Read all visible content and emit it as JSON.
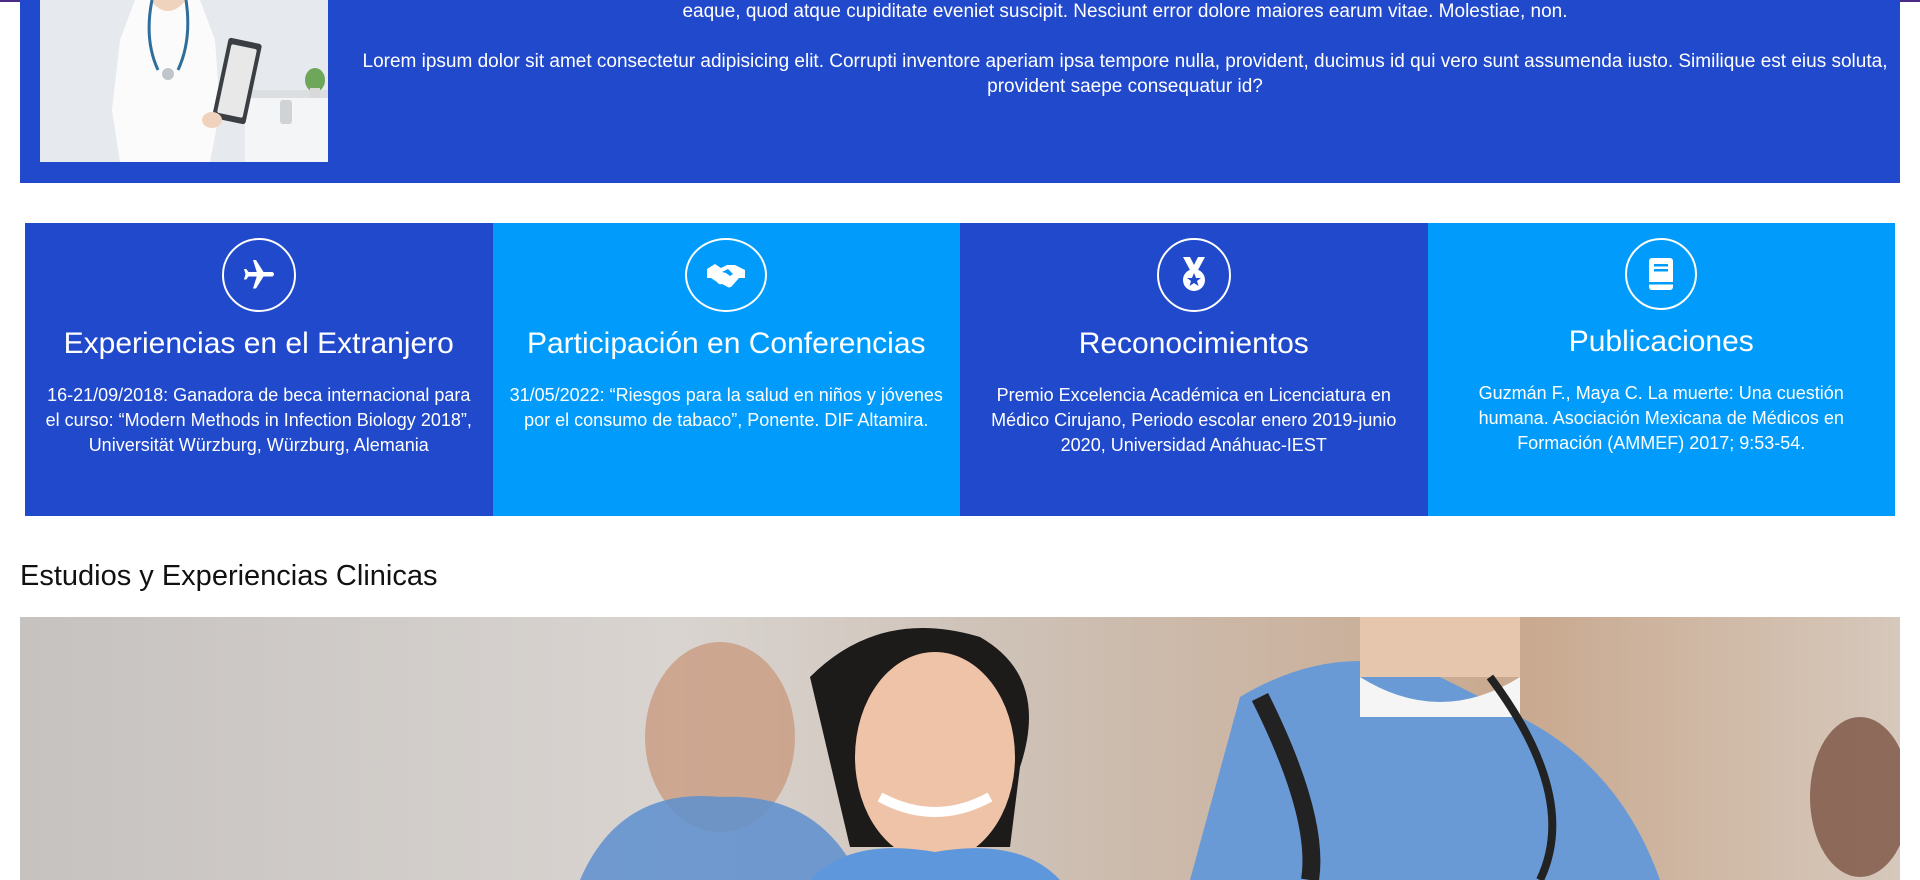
{
  "intro": {
    "paragraph_1": "eaque, quod atque cupiditate eveniet suscipit. Nesciunt error dolore maiores earum vitae. Molestiae, non.",
    "paragraph_2": "Lorem ipsum dolor sit amet consectetur adipisicing elit. Corrupti inventore aperiam ipsa tempore nulla, provident, ducimus id qui vero sunt assumenda iusto. Similique est eius soluta, provident saepe consequatur id?"
  },
  "cards": [
    {
      "icon": "airplane-icon",
      "title": "Experiencias en el Extranjero",
      "text": "16-21/09/2018: Ganadora de beca internacional para el curso: “Modern Methods in Infection Biology 2018”, Universität Würzburg, Würzburg, Alemania"
    },
    {
      "icon": "handshake-icon",
      "title": "Participación en Conferencias",
      "text": "31/05/2022: “Riesgos para la salud en niños y jóvenes por el consumo de tabaco”, Ponente. DIF Altamira."
    },
    {
      "icon": "medal-icon",
      "title": "Reconocimientos",
      "text": "Premio Excelencia Académica en Licenciatura en Médico Cirujano, Periodo escolar enero 2019-junio 2020, Universidad Anáhuac-IEST"
    },
    {
      "icon": "book-icon",
      "title": "Publicaciones",
      "text": "Guzmán F., Maya C. La muerte: Una cuestión humana. Asociación Mexicana de Médicos en Formación (AMMEF) 2017; 9:53-54."
    }
  ],
  "section": {
    "title": "Estudios y Experiencias Clinicas"
  },
  "colors": {
    "dark_blue": "#2149cc",
    "light_blue": "#019cfb",
    "white": "#ffffff"
  }
}
